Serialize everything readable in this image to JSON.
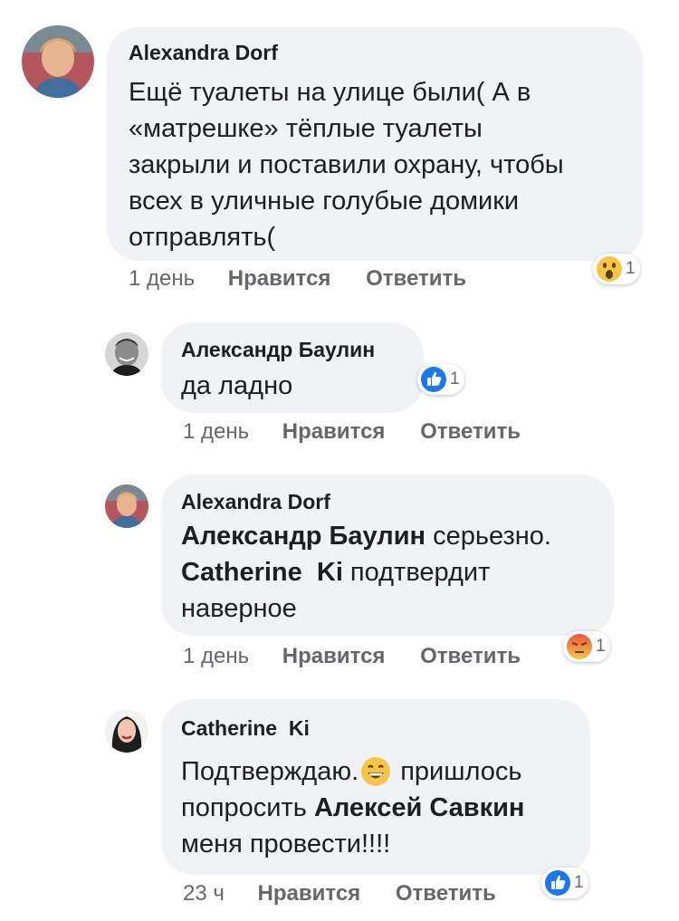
{
  "comments": [
    {
      "author": "Alexandra Dorf",
      "lines": [
        "Ещё туалеты на улице были( А в",
        "«матрешке» тёплые туалеты",
        "закрыли и поставили охрану, чтобы",
        "всех в уличные голубые домики",
        "отправлять("
      ],
      "time": "1 день",
      "like": "Нравится",
      "reply": "Ответить",
      "reaction": {
        "icon": "wow-emoji-icon",
        "count": "1"
      }
    },
    {
      "author": "Александр Баулин",
      "lines": [
        "да ладно"
      ],
      "time": "1 день",
      "like": "Нравится",
      "reply": "Ответить",
      "reaction": {
        "icon": "like-icon",
        "count": "1"
      }
    },
    {
      "author": "Alexandra Dorf",
      "mention1": "Александр Баулин",
      "text1": " серьезно.",
      "mention2": "Catherine  Ki",
      "text2": " подтвердит",
      "text3": "наверное",
      "time": "1 день",
      "like": "Нравится",
      "reply": "Ответить",
      "reaction": {
        "icon": "angry-emoji-icon",
        "count": "1"
      }
    },
    {
      "author": "Catherine  Ki",
      "text1": "Подтверждаю.",
      "text1b": " пришлось",
      "text2": "попросить ",
      "mention": "Алексей Савкин",
      "text3": "меня провести!!!!",
      "time": "23 ч",
      "like": "Нравится",
      "reply": "Ответить",
      "reaction": {
        "icon": "like-icon",
        "count": "1"
      }
    }
  ],
  "colors": {
    "bubble": "#f0f2f5",
    "like_blue": "#1877f2",
    "meta": "#65676b"
  }
}
